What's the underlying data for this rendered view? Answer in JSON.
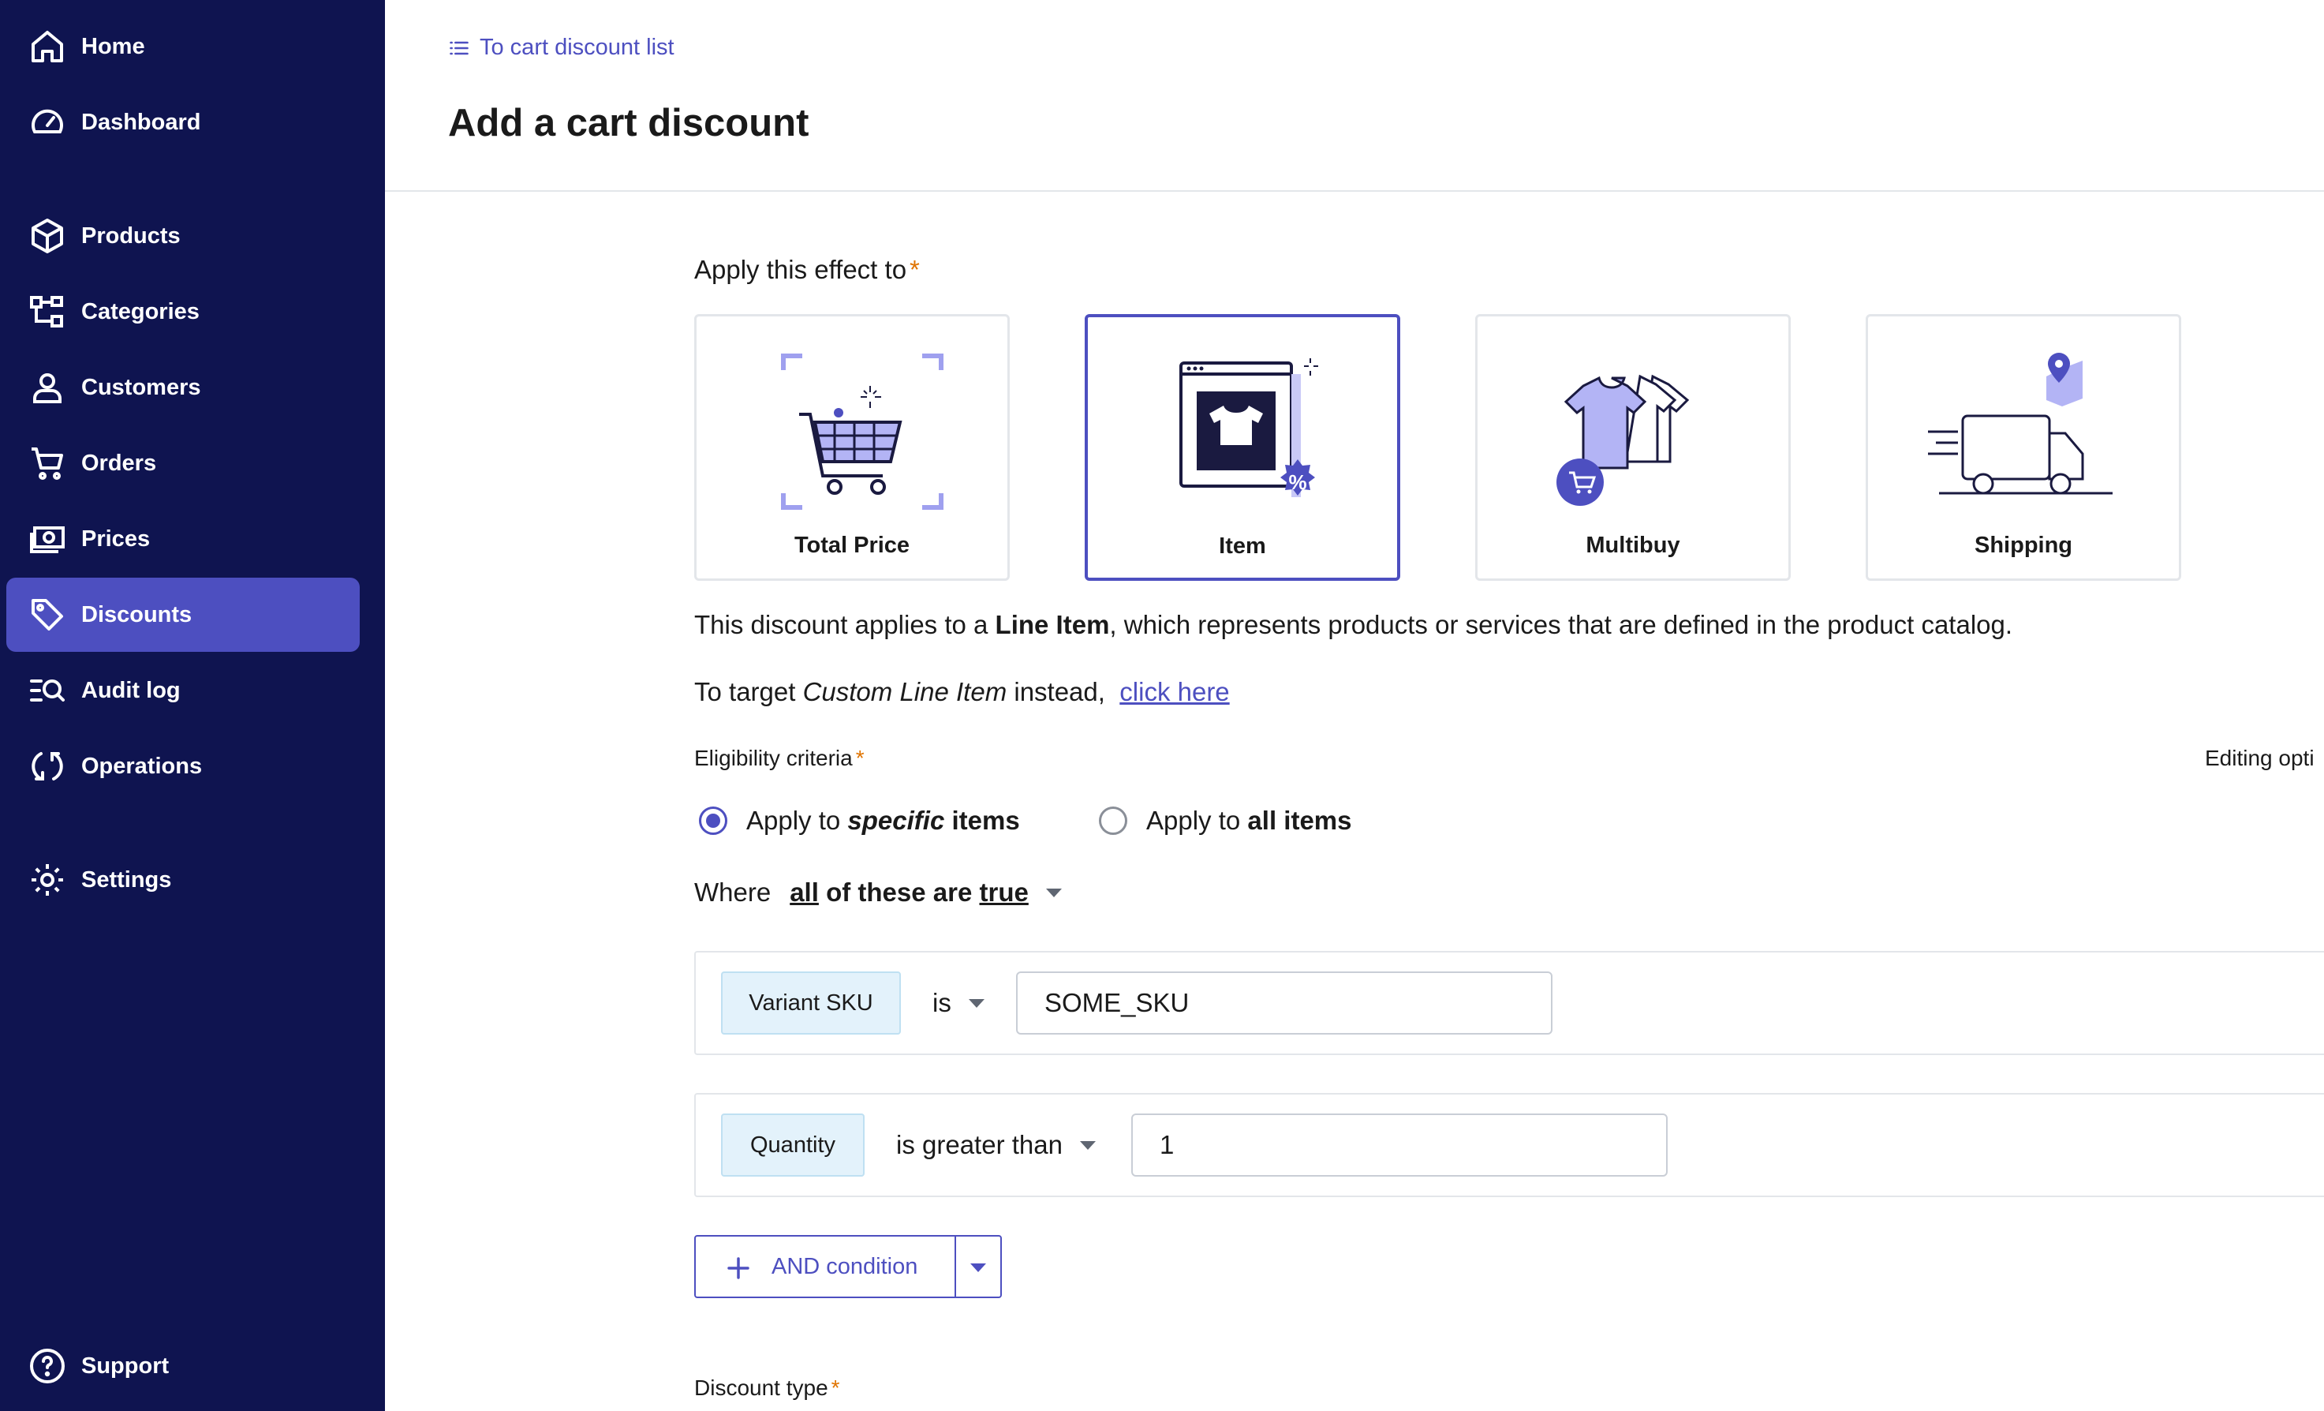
{
  "sidebar": {
    "items": [
      {
        "label": "Home",
        "icon": "home-icon"
      },
      {
        "label": "Dashboard",
        "icon": "gauge-icon"
      },
      {
        "label": "Products",
        "icon": "cube-icon"
      },
      {
        "label": "Categories",
        "icon": "hierarchy-icon"
      },
      {
        "label": "Customers",
        "icon": "person-icon"
      },
      {
        "label": "Orders",
        "icon": "cart-icon"
      },
      {
        "label": "Prices",
        "icon": "money-icon"
      },
      {
        "label": "Discounts",
        "icon": "tag-icon",
        "active": true
      },
      {
        "label": "Audit log",
        "icon": "search-list-icon"
      },
      {
        "label": "Operations",
        "icon": "refresh-icon"
      },
      {
        "label": "Settings",
        "icon": "gear-icon"
      },
      {
        "label": "Support",
        "icon": "help-icon"
      }
    ]
  },
  "header": {
    "back_link": "To cart discount list",
    "title": "Add a cart discount"
  },
  "effect": {
    "label": "Apply this effect to",
    "required_mark": "*",
    "options": [
      {
        "label": "Total Price",
        "selected": false
      },
      {
        "label": "Item",
        "selected": true
      },
      {
        "label": "Multibuy",
        "selected": false
      },
      {
        "label": "Shipping",
        "selected": false
      }
    ]
  },
  "description": {
    "line1_pre": "This discount applies to a ",
    "line1_bold": "Line Item",
    "line1_post": ", which represents products or services that are defined in the product catalog.",
    "line2_pre": "To target ",
    "line2_italic": "Custom Line Item",
    "line2_post": " instead, ",
    "line2_link": "click here"
  },
  "eligibility": {
    "label": "Eligibility criteria",
    "required_mark": "*",
    "editing_options": "Editing opti",
    "radio_specific_pre": "Apply to ",
    "radio_specific_italic": "specific",
    "radio_specific_post": " items",
    "radio_all_pre": "Apply to ",
    "radio_all_bold": "all items",
    "selected": "specific",
    "where_label": "Where",
    "where_all": "all",
    "where_mid": " of these are ",
    "where_true": "true"
  },
  "conditions": [
    {
      "field": "Variant SKU",
      "operator": "is",
      "value": "SOME_SKU"
    },
    {
      "field": "Quantity",
      "operator": "is greater than",
      "value": "1"
    }
  ],
  "and_button": {
    "label": "AND condition"
  },
  "discount_type": {
    "label": "Discount type",
    "required_mark": "*"
  },
  "colors": {
    "sidebar_bg": "#0f1450",
    "accent": "#4d4fc0",
    "required": "#e07400"
  }
}
